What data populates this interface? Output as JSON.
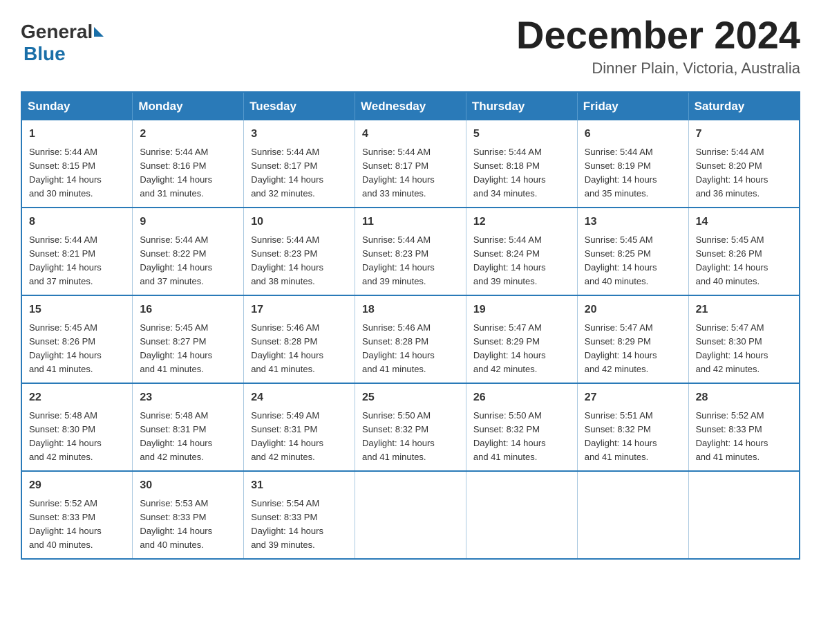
{
  "header": {
    "logo_general": "General",
    "logo_blue": "Blue",
    "month_title": "December 2024",
    "location": "Dinner Plain, Victoria, Australia"
  },
  "calendar": {
    "columns": [
      "Sunday",
      "Monday",
      "Tuesday",
      "Wednesday",
      "Thursday",
      "Friday",
      "Saturday"
    ],
    "rows": [
      [
        {
          "day": "1",
          "sunrise": "5:44 AM",
          "sunset": "8:15 PM",
          "daylight": "14 hours and 30 minutes."
        },
        {
          "day": "2",
          "sunrise": "5:44 AM",
          "sunset": "8:16 PM",
          "daylight": "14 hours and 31 minutes."
        },
        {
          "day": "3",
          "sunrise": "5:44 AM",
          "sunset": "8:17 PM",
          "daylight": "14 hours and 32 minutes."
        },
        {
          "day": "4",
          "sunrise": "5:44 AM",
          "sunset": "8:17 PM",
          "daylight": "14 hours and 33 minutes."
        },
        {
          "day": "5",
          "sunrise": "5:44 AM",
          "sunset": "8:18 PM",
          "daylight": "14 hours and 34 minutes."
        },
        {
          "day": "6",
          "sunrise": "5:44 AM",
          "sunset": "8:19 PM",
          "daylight": "14 hours and 35 minutes."
        },
        {
          "day": "7",
          "sunrise": "5:44 AM",
          "sunset": "8:20 PM",
          "daylight": "14 hours and 36 minutes."
        }
      ],
      [
        {
          "day": "8",
          "sunrise": "5:44 AM",
          "sunset": "8:21 PM",
          "daylight": "14 hours and 37 minutes."
        },
        {
          "day": "9",
          "sunrise": "5:44 AM",
          "sunset": "8:22 PM",
          "daylight": "14 hours and 37 minutes."
        },
        {
          "day": "10",
          "sunrise": "5:44 AM",
          "sunset": "8:23 PM",
          "daylight": "14 hours and 38 minutes."
        },
        {
          "day": "11",
          "sunrise": "5:44 AM",
          "sunset": "8:23 PM",
          "daylight": "14 hours and 39 minutes."
        },
        {
          "day": "12",
          "sunrise": "5:44 AM",
          "sunset": "8:24 PM",
          "daylight": "14 hours and 39 minutes."
        },
        {
          "day": "13",
          "sunrise": "5:45 AM",
          "sunset": "8:25 PM",
          "daylight": "14 hours and 40 minutes."
        },
        {
          "day": "14",
          "sunrise": "5:45 AM",
          "sunset": "8:26 PM",
          "daylight": "14 hours and 40 minutes."
        }
      ],
      [
        {
          "day": "15",
          "sunrise": "5:45 AM",
          "sunset": "8:26 PM",
          "daylight": "14 hours and 41 minutes."
        },
        {
          "day": "16",
          "sunrise": "5:45 AM",
          "sunset": "8:27 PM",
          "daylight": "14 hours and 41 minutes."
        },
        {
          "day": "17",
          "sunrise": "5:46 AM",
          "sunset": "8:28 PM",
          "daylight": "14 hours and 41 minutes."
        },
        {
          "day": "18",
          "sunrise": "5:46 AM",
          "sunset": "8:28 PM",
          "daylight": "14 hours and 41 minutes."
        },
        {
          "day": "19",
          "sunrise": "5:47 AM",
          "sunset": "8:29 PM",
          "daylight": "14 hours and 42 minutes."
        },
        {
          "day": "20",
          "sunrise": "5:47 AM",
          "sunset": "8:29 PM",
          "daylight": "14 hours and 42 minutes."
        },
        {
          "day": "21",
          "sunrise": "5:47 AM",
          "sunset": "8:30 PM",
          "daylight": "14 hours and 42 minutes."
        }
      ],
      [
        {
          "day": "22",
          "sunrise": "5:48 AM",
          "sunset": "8:30 PM",
          "daylight": "14 hours and 42 minutes."
        },
        {
          "day": "23",
          "sunrise": "5:48 AM",
          "sunset": "8:31 PM",
          "daylight": "14 hours and 42 minutes."
        },
        {
          "day": "24",
          "sunrise": "5:49 AM",
          "sunset": "8:31 PM",
          "daylight": "14 hours and 42 minutes."
        },
        {
          "day": "25",
          "sunrise": "5:50 AM",
          "sunset": "8:32 PM",
          "daylight": "14 hours and 41 minutes."
        },
        {
          "day": "26",
          "sunrise": "5:50 AM",
          "sunset": "8:32 PM",
          "daylight": "14 hours and 41 minutes."
        },
        {
          "day": "27",
          "sunrise": "5:51 AM",
          "sunset": "8:32 PM",
          "daylight": "14 hours and 41 minutes."
        },
        {
          "day": "28",
          "sunrise": "5:52 AM",
          "sunset": "8:33 PM",
          "daylight": "14 hours and 41 minutes."
        }
      ],
      [
        {
          "day": "29",
          "sunrise": "5:52 AM",
          "sunset": "8:33 PM",
          "daylight": "14 hours and 40 minutes."
        },
        {
          "day": "30",
          "sunrise": "5:53 AM",
          "sunset": "8:33 PM",
          "daylight": "14 hours and 40 minutes."
        },
        {
          "day": "31",
          "sunrise": "5:54 AM",
          "sunset": "8:33 PM",
          "daylight": "14 hours and 39 minutes."
        },
        null,
        null,
        null,
        null
      ]
    ]
  }
}
